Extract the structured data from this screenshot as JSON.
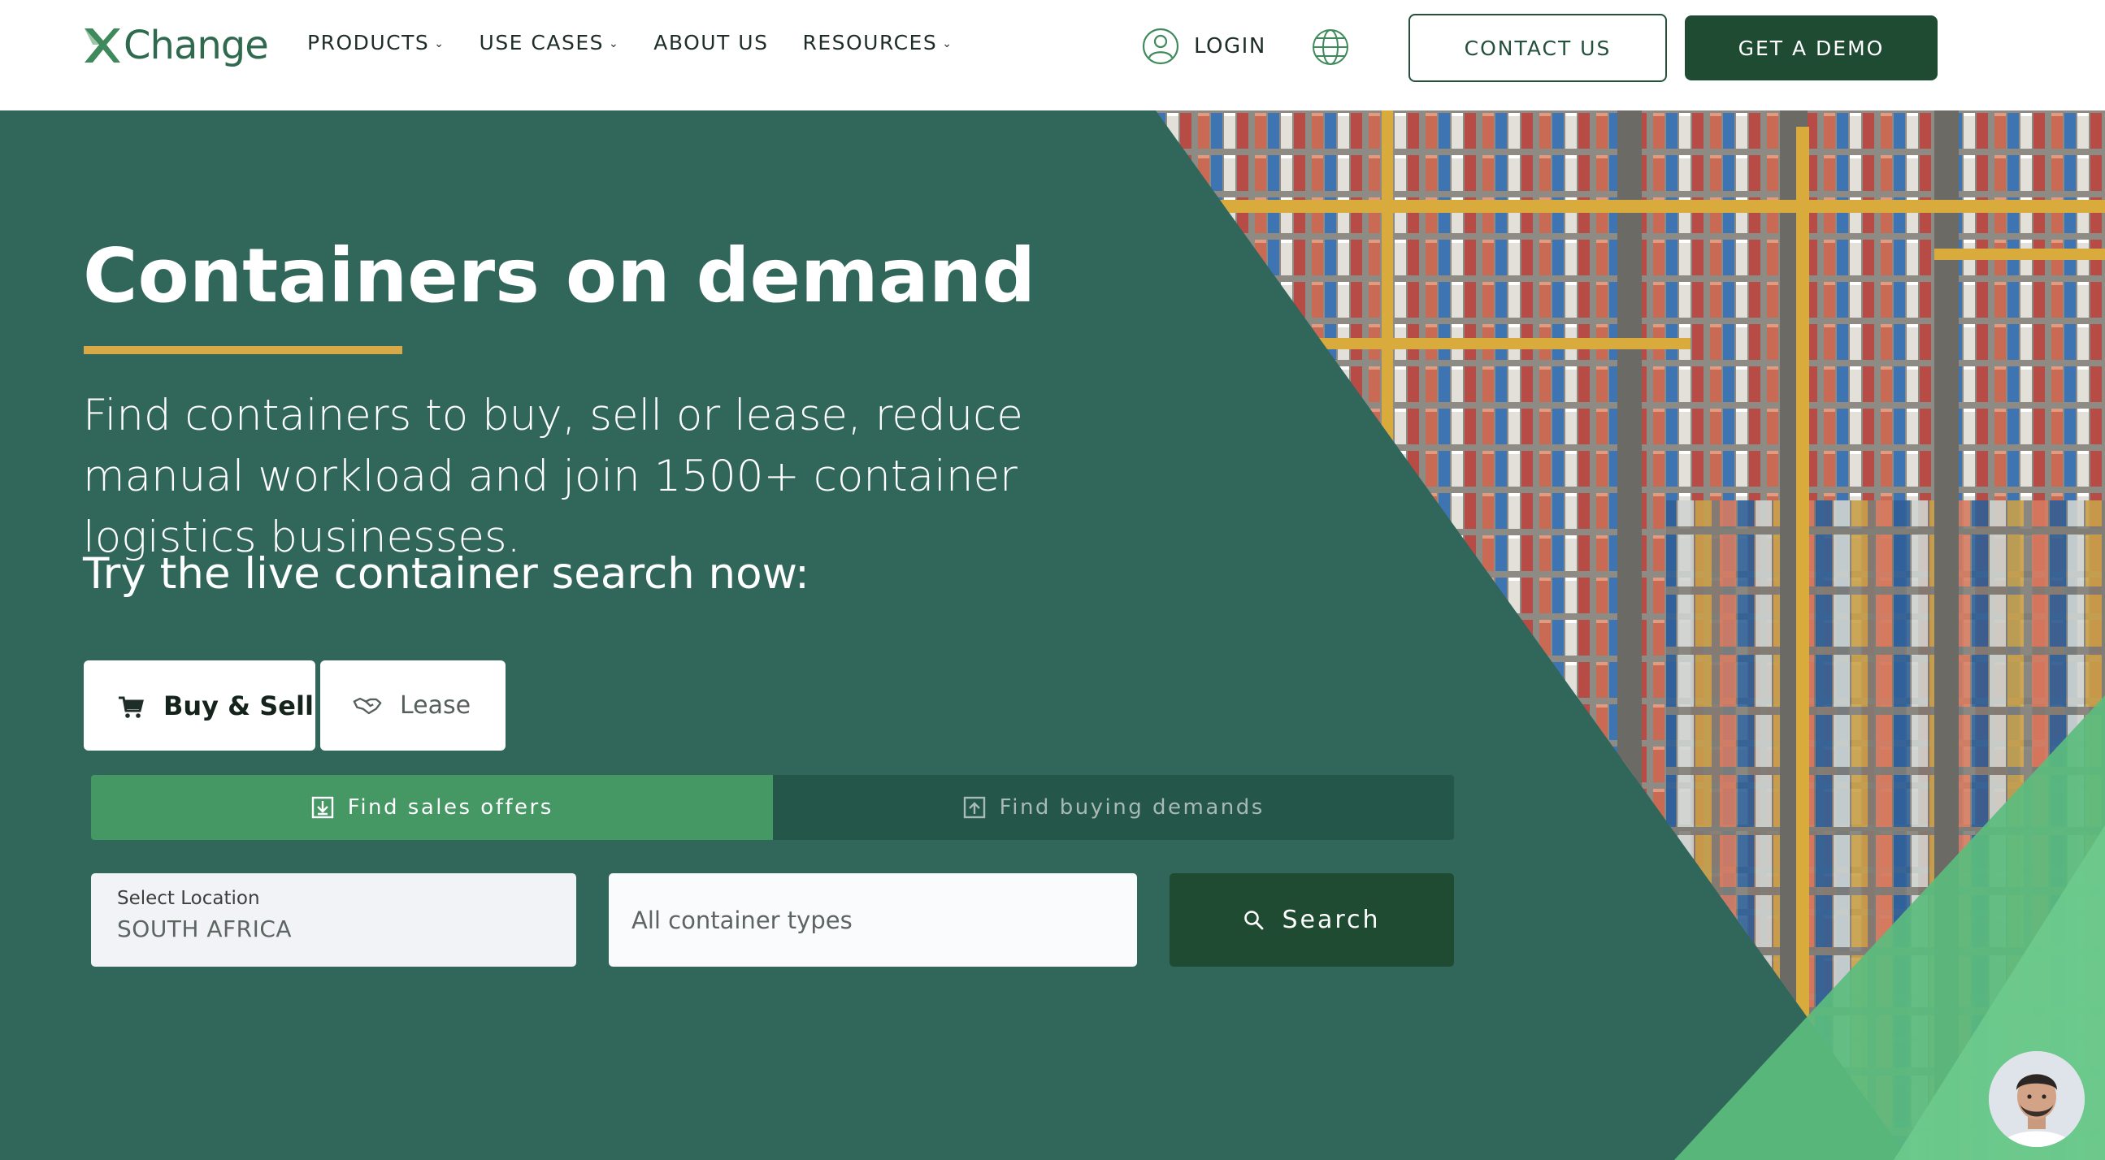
{
  "brand": {
    "name": "Change",
    "mark_color": "#3f8a5c"
  },
  "nav": {
    "items": [
      {
        "label": "PRODUCTS",
        "has_dropdown": true
      },
      {
        "label": "USE CASES",
        "has_dropdown": true
      },
      {
        "label": "ABOUT US",
        "has_dropdown": false
      },
      {
        "label": "RESOURCES",
        "has_dropdown": true
      }
    ],
    "login_label": "LOGIN",
    "contact_label": "CONTACT US",
    "demo_label": "GET A DEMO",
    "icons": {
      "login": "user-circle-icon",
      "language": "globe-icon",
      "dropdown": "chevron-down-icon"
    }
  },
  "hero": {
    "title": "Containers on demand",
    "subtitle": "Find containers to buy, sell or lease, reduce manual workload and join 1500+ container logistics businesses.",
    "try_text": "Try the live container search now:",
    "background_color": "#31675a",
    "accent_color": "#d9a847"
  },
  "search": {
    "modes": [
      {
        "label": "Buy & Sell",
        "icon": "cart-icon",
        "active": true
      },
      {
        "label": "Lease",
        "icon": "handshake-icon",
        "active": false
      }
    ],
    "offer_tabs": [
      {
        "label": "Find sales offers",
        "icon": "download-box-icon",
        "active": true
      },
      {
        "label": "Find buying demands",
        "icon": "upload-box-icon",
        "active": false
      }
    ],
    "location_caption": "Select Location",
    "location_value": "SOUTH AFRICA",
    "container_type_placeholder": "All container types",
    "search_label": "Search",
    "search_icon": "search-icon"
  },
  "chat": {
    "icon": "chat-agent-avatar"
  }
}
